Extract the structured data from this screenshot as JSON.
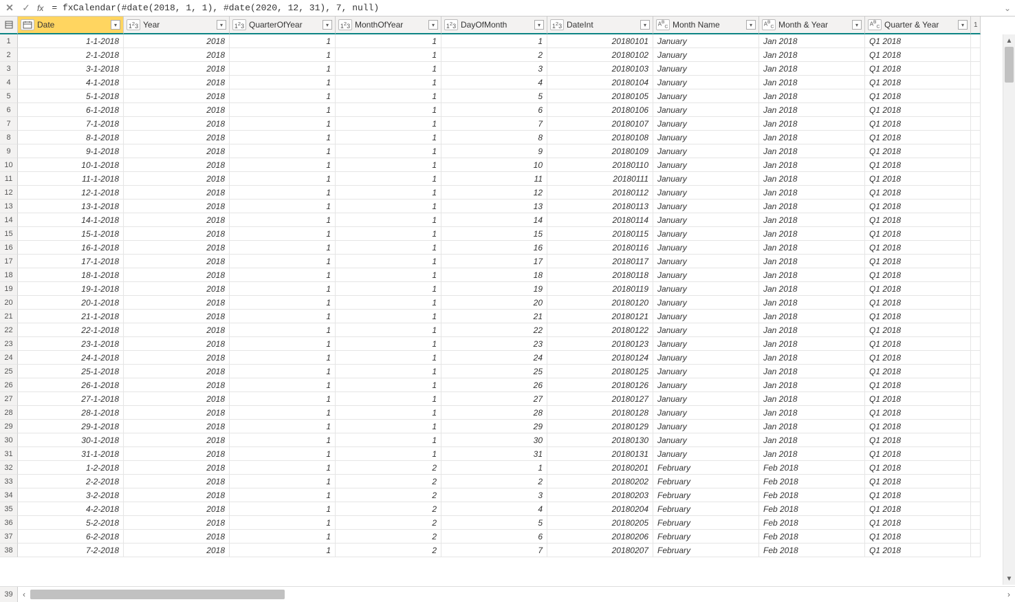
{
  "formula_bar": {
    "fx_label": "fx",
    "formula": "= fxCalendar(#date(2018, 1, 1), #date(2020, 12, 31), 7, null)"
  },
  "columns": [
    {
      "key": "Date",
      "label": "Date",
      "type_icon": "date",
      "width_class": "w-date",
      "align": "num",
      "selected": true
    },
    {
      "key": "Year",
      "label": "Year",
      "type_icon": "123",
      "width_class": "w-year",
      "align": "num"
    },
    {
      "key": "QuarterOfYear",
      "label": "QuarterOfYear",
      "type_icon": "123",
      "width_class": "w-q",
      "align": "num"
    },
    {
      "key": "MonthOfYear",
      "label": "MonthOfYear",
      "type_icon": "123",
      "width_class": "w-m",
      "align": "num"
    },
    {
      "key": "DayOfMonth",
      "label": "DayOfMonth",
      "type_icon": "123",
      "width_class": "w-d",
      "align": "num"
    },
    {
      "key": "DateInt",
      "label": "DateInt",
      "type_icon": "123",
      "width_class": "w-di",
      "align": "num"
    },
    {
      "key": "MonthName",
      "label": "Month Name",
      "type_icon": "ABC",
      "width_class": "w-mn",
      "align": "txt"
    },
    {
      "key": "MonthYear",
      "label": "Month & Year",
      "type_icon": "ABC",
      "width_class": "w-my",
      "align": "txt"
    },
    {
      "key": "QuarterYear",
      "label": "Quarter & Year",
      "type_icon": "ABC",
      "width_class": "w-qy",
      "align": "txt"
    }
  ],
  "extra_column_peek": {
    "type_icon": "1"
  },
  "rows": [
    {
      "n": 1,
      "Date": "1-1-2018",
      "Year": "2018",
      "QuarterOfYear": "1",
      "MonthOfYear": "1",
      "DayOfMonth": "1",
      "DateInt": "20180101",
      "MonthName": "January",
      "MonthYear": "Jan 2018",
      "QuarterYear": "Q1 2018"
    },
    {
      "n": 2,
      "Date": "2-1-2018",
      "Year": "2018",
      "QuarterOfYear": "1",
      "MonthOfYear": "1",
      "DayOfMonth": "2",
      "DateInt": "20180102",
      "MonthName": "January",
      "MonthYear": "Jan 2018",
      "QuarterYear": "Q1 2018"
    },
    {
      "n": 3,
      "Date": "3-1-2018",
      "Year": "2018",
      "QuarterOfYear": "1",
      "MonthOfYear": "1",
      "DayOfMonth": "3",
      "DateInt": "20180103",
      "MonthName": "January",
      "MonthYear": "Jan 2018",
      "QuarterYear": "Q1 2018"
    },
    {
      "n": 4,
      "Date": "4-1-2018",
      "Year": "2018",
      "QuarterOfYear": "1",
      "MonthOfYear": "1",
      "DayOfMonth": "4",
      "DateInt": "20180104",
      "MonthName": "January",
      "MonthYear": "Jan 2018",
      "QuarterYear": "Q1 2018"
    },
    {
      "n": 5,
      "Date": "5-1-2018",
      "Year": "2018",
      "QuarterOfYear": "1",
      "MonthOfYear": "1",
      "DayOfMonth": "5",
      "DateInt": "20180105",
      "MonthName": "January",
      "MonthYear": "Jan 2018",
      "QuarterYear": "Q1 2018"
    },
    {
      "n": 6,
      "Date": "6-1-2018",
      "Year": "2018",
      "QuarterOfYear": "1",
      "MonthOfYear": "1",
      "DayOfMonth": "6",
      "DateInt": "20180106",
      "MonthName": "January",
      "MonthYear": "Jan 2018",
      "QuarterYear": "Q1 2018"
    },
    {
      "n": 7,
      "Date": "7-1-2018",
      "Year": "2018",
      "QuarterOfYear": "1",
      "MonthOfYear": "1",
      "DayOfMonth": "7",
      "DateInt": "20180107",
      "MonthName": "January",
      "MonthYear": "Jan 2018",
      "QuarterYear": "Q1 2018"
    },
    {
      "n": 8,
      "Date": "8-1-2018",
      "Year": "2018",
      "QuarterOfYear": "1",
      "MonthOfYear": "1",
      "DayOfMonth": "8",
      "DateInt": "20180108",
      "MonthName": "January",
      "MonthYear": "Jan 2018",
      "QuarterYear": "Q1 2018"
    },
    {
      "n": 9,
      "Date": "9-1-2018",
      "Year": "2018",
      "QuarterOfYear": "1",
      "MonthOfYear": "1",
      "DayOfMonth": "9",
      "DateInt": "20180109",
      "MonthName": "January",
      "MonthYear": "Jan 2018",
      "QuarterYear": "Q1 2018"
    },
    {
      "n": 10,
      "Date": "10-1-2018",
      "Year": "2018",
      "QuarterOfYear": "1",
      "MonthOfYear": "1",
      "DayOfMonth": "10",
      "DateInt": "20180110",
      "MonthName": "January",
      "MonthYear": "Jan 2018",
      "QuarterYear": "Q1 2018"
    },
    {
      "n": 11,
      "Date": "11-1-2018",
      "Year": "2018",
      "QuarterOfYear": "1",
      "MonthOfYear": "1",
      "DayOfMonth": "11",
      "DateInt": "20180111",
      "MonthName": "January",
      "MonthYear": "Jan 2018",
      "QuarterYear": "Q1 2018"
    },
    {
      "n": 12,
      "Date": "12-1-2018",
      "Year": "2018",
      "QuarterOfYear": "1",
      "MonthOfYear": "1",
      "DayOfMonth": "12",
      "DateInt": "20180112",
      "MonthName": "January",
      "MonthYear": "Jan 2018",
      "QuarterYear": "Q1 2018"
    },
    {
      "n": 13,
      "Date": "13-1-2018",
      "Year": "2018",
      "QuarterOfYear": "1",
      "MonthOfYear": "1",
      "DayOfMonth": "13",
      "DateInt": "20180113",
      "MonthName": "January",
      "MonthYear": "Jan 2018",
      "QuarterYear": "Q1 2018"
    },
    {
      "n": 14,
      "Date": "14-1-2018",
      "Year": "2018",
      "QuarterOfYear": "1",
      "MonthOfYear": "1",
      "DayOfMonth": "14",
      "DateInt": "20180114",
      "MonthName": "January",
      "MonthYear": "Jan 2018",
      "QuarterYear": "Q1 2018"
    },
    {
      "n": 15,
      "Date": "15-1-2018",
      "Year": "2018",
      "QuarterOfYear": "1",
      "MonthOfYear": "1",
      "DayOfMonth": "15",
      "DateInt": "20180115",
      "MonthName": "January",
      "MonthYear": "Jan 2018",
      "QuarterYear": "Q1 2018"
    },
    {
      "n": 16,
      "Date": "16-1-2018",
      "Year": "2018",
      "QuarterOfYear": "1",
      "MonthOfYear": "1",
      "DayOfMonth": "16",
      "DateInt": "20180116",
      "MonthName": "January",
      "MonthYear": "Jan 2018",
      "QuarterYear": "Q1 2018"
    },
    {
      "n": 17,
      "Date": "17-1-2018",
      "Year": "2018",
      "QuarterOfYear": "1",
      "MonthOfYear": "1",
      "DayOfMonth": "17",
      "DateInt": "20180117",
      "MonthName": "January",
      "MonthYear": "Jan 2018",
      "QuarterYear": "Q1 2018"
    },
    {
      "n": 18,
      "Date": "18-1-2018",
      "Year": "2018",
      "QuarterOfYear": "1",
      "MonthOfYear": "1",
      "DayOfMonth": "18",
      "DateInt": "20180118",
      "MonthName": "January",
      "MonthYear": "Jan 2018",
      "QuarterYear": "Q1 2018"
    },
    {
      "n": 19,
      "Date": "19-1-2018",
      "Year": "2018",
      "QuarterOfYear": "1",
      "MonthOfYear": "1",
      "DayOfMonth": "19",
      "DateInt": "20180119",
      "MonthName": "January",
      "MonthYear": "Jan 2018",
      "QuarterYear": "Q1 2018"
    },
    {
      "n": 20,
      "Date": "20-1-2018",
      "Year": "2018",
      "QuarterOfYear": "1",
      "MonthOfYear": "1",
      "DayOfMonth": "20",
      "DateInt": "20180120",
      "MonthName": "January",
      "MonthYear": "Jan 2018",
      "QuarterYear": "Q1 2018"
    },
    {
      "n": 21,
      "Date": "21-1-2018",
      "Year": "2018",
      "QuarterOfYear": "1",
      "MonthOfYear": "1",
      "DayOfMonth": "21",
      "DateInt": "20180121",
      "MonthName": "January",
      "MonthYear": "Jan 2018",
      "QuarterYear": "Q1 2018"
    },
    {
      "n": 22,
      "Date": "22-1-2018",
      "Year": "2018",
      "QuarterOfYear": "1",
      "MonthOfYear": "1",
      "DayOfMonth": "22",
      "DateInt": "20180122",
      "MonthName": "January",
      "MonthYear": "Jan 2018",
      "QuarterYear": "Q1 2018"
    },
    {
      "n": 23,
      "Date": "23-1-2018",
      "Year": "2018",
      "QuarterOfYear": "1",
      "MonthOfYear": "1",
      "DayOfMonth": "23",
      "DateInt": "20180123",
      "MonthName": "January",
      "MonthYear": "Jan 2018",
      "QuarterYear": "Q1 2018"
    },
    {
      "n": 24,
      "Date": "24-1-2018",
      "Year": "2018",
      "QuarterOfYear": "1",
      "MonthOfYear": "1",
      "DayOfMonth": "24",
      "DateInt": "20180124",
      "MonthName": "January",
      "MonthYear": "Jan 2018",
      "QuarterYear": "Q1 2018"
    },
    {
      "n": 25,
      "Date": "25-1-2018",
      "Year": "2018",
      "QuarterOfYear": "1",
      "MonthOfYear": "1",
      "DayOfMonth": "25",
      "DateInt": "20180125",
      "MonthName": "January",
      "MonthYear": "Jan 2018",
      "QuarterYear": "Q1 2018"
    },
    {
      "n": 26,
      "Date": "26-1-2018",
      "Year": "2018",
      "QuarterOfYear": "1",
      "MonthOfYear": "1",
      "DayOfMonth": "26",
      "DateInt": "20180126",
      "MonthName": "January",
      "MonthYear": "Jan 2018",
      "QuarterYear": "Q1 2018"
    },
    {
      "n": 27,
      "Date": "27-1-2018",
      "Year": "2018",
      "QuarterOfYear": "1",
      "MonthOfYear": "1",
      "DayOfMonth": "27",
      "DateInt": "20180127",
      "MonthName": "January",
      "MonthYear": "Jan 2018",
      "QuarterYear": "Q1 2018"
    },
    {
      "n": 28,
      "Date": "28-1-2018",
      "Year": "2018",
      "QuarterOfYear": "1",
      "MonthOfYear": "1",
      "DayOfMonth": "28",
      "DateInt": "20180128",
      "MonthName": "January",
      "MonthYear": "Jan 2018",
      "QuarterYear": "Q1 2018"
    },
    {
      "n": 29,
      "Date": "29-1-2018",
      "Year": "2018",
      "QuarterOfYear": "1",
      "MonthOfYear": "1",
      "DayOfMonth": "29",
      "DateInt": "20180129",
      "MonthName": "January",
      "MonthYear": "Jan 2018",
      "QuarterYear": "Q1 2018"
    },
    {
      "n": 30,
      "Date": "30-1-2018",
      "Year": "2018",
      "QuarterOfYear": "1",
      "MonthOfYear": "1",
      "DayOfMonth": "30",
      "DateInt": "20180130",
      "MonthName": "January",
      "MonthYear": "Jan 2018",
      "QuarterYear": "Q1 2018"
    },
    {
      "n": 31,
      "Date": "31-1-2018",
      "Year": "2018",
      "QuarterOfYear": "1",
      "MonthOfYear": "1",
      "DayOfMonth": "31",
      "DateInt": "20180131",
      "MonthName": "January",
      "MonthYear": "Jan 2018",
      "QuarterYear": "Q1 2018"
    },
    {
      "n": 32,
      "Date": "1-2-2018",
      "Year": "2018",
      "QuarterOfYear": "1",
      "MonthOfYear": "2",
      "DayOfMonth": "1",
      "DateInt": "20180201",
      "MonthName": "February",
      "MonthYear": "Feb 2018",
      "QuarterYear": "Q1 2018"
    },
    {
      "n": 33,
      "Date": "2-2-2018",
      "Year": "2018",
      "QuarterOfYear": "1",
      "MonthOfYear": "2",
      "DayOfMonth": "2",
      "DateInt": "20180202",
      "MonthName": "February",
      "MonthYear": "Feb 2018",
      "QuarterYear": "Q1 2018"
    },
    {
      "n": 34,
      "Date": "3-2-2018",
      "Year": "2018",
      "QuarterOfYear": "1",
      "MonthOfYear": "2",
      "DayOfMonth": "3",
      "DateInt": "20180203",
      "MonthName": "February",
      "MonthYear": "Feb 2018",
      "QuarterYear": "Q1 2018"
    },
    {
      "n": 35,
      "Date": "4-2-2018",
      "Year": "2018",
      "QuarterOfYear": "1",
      "MonthOfYear": "2",
      "DayOfMonth": "4",
      "DateInt": "20180204",
      "MonthName": "February",
      "MonthYear": "Feb 2018",
      "QuarterYear": "Q1 2018"
    },
    {
      "n": 36,
      "Date": "5-2-2018",
      "Year": "2018",
      "QuarterOfYear": "1",
      "MonthOfYear": "2",
      "DayOfMonth": "5",
      "DateInt": "20180205",
      "MonthName": "February",
      "MonthYear": "Feb 2018",
      "QuarterYear": "Q1 2018"
    },
    {
      "n": 37,
      "Date": "6-2-2018",
      "Year": "2018",
      "QuarterOfYear": "1",
      "MonthOfYear": "2",
      "DayOfMonth": "6",
      "DateInt": "20180206",
      "MonthName": "February",
      "MonthYear": "Feb 2018",
      "QuarterYear": "Q1 2018"
    },
    {
      "n": 38,
      "Date": "7-2-2018",
      "Year": "2018",
      "QuarterOfYear": "1",
      "MonthOfYear": "2",
      "DayOfMonth": "7",
      "DateInt": "20180207",
      "MonthName": "February",
      "MonthYear": "Feb 2018",
      "QuarterYear": "Q1 2018"
    }
  ],
  "next_row_number": "39"
}
